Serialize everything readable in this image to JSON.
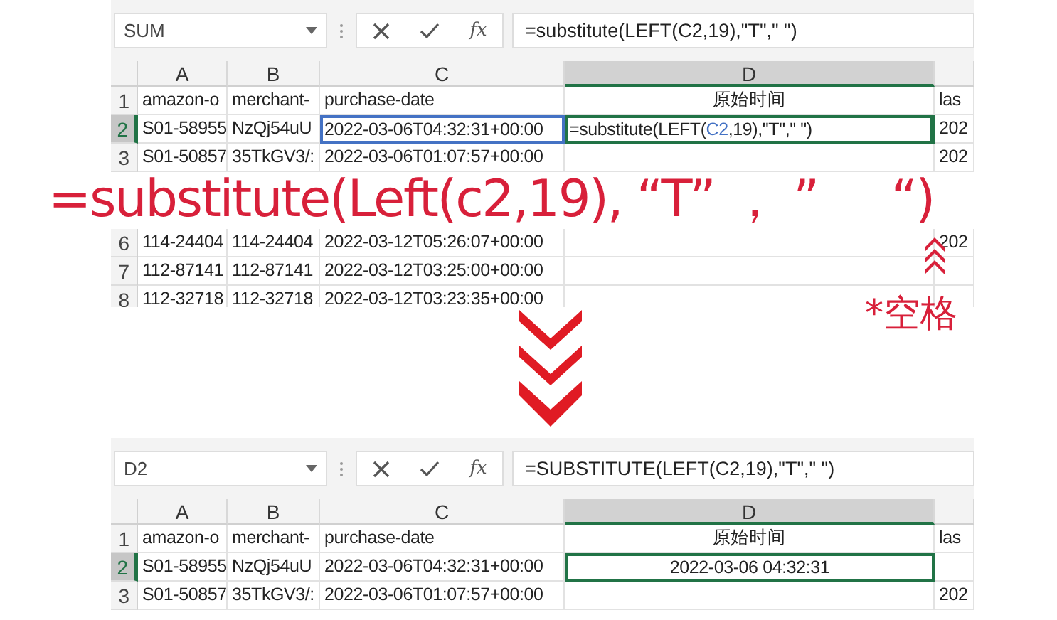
{
  "top_sheet": {
    "name_box": "SUM",
    "function_label": "fx",
    "formula": "=substitute(LEFT(C2,19),\"T\",\" \")",
    "editing": true,
    "columns": [
      {
        "label": "A",
        "selected": false
      },
      {
        "label": "B",
        "selected": false
      },
      {
        "label": "C",
        "selected": false
      },
      {
        "label": "D",
        "selected": true
      },
      {
        "selected": false
      }
    ],
    "rows": [
      {
        "number": "1",
        "selected": false,
        "cells": [
          {
            "text": "amazon-o",
            "selected": false
          },
          {
            "text": "merchant-",
            "selected": false
          },
          {
            "text": "purchase-date",
            "selected": false
          },
          {
            "text": "原始时间",
            "centered": true,
            "selected": false
          },
          {
            "text": "las",
            "selected": false
          }
        ]
      },
      {
        "number": "2",
        "selected": true,
        "cells": [
          {
            "text": "S01-58955",
            "selected": false
          },
          {
            "text": "NzQj54uU",
            "selected": false
          },
          {
            "text": "2022-03-06T04:32:31+00:00",
            "referenced": true,
            "selected": false
          },
          {
            "parts": [
              {
                "text": "=substitute(LEFT(",
                "kind": "plain"
              },
              {
                "text": "C2",
                "kind": "ref"
              },
              {
                "text": ",19),\"T\",\" \")",
                "kind": "plain"
              }
            ],
            "selected": true
          },
          {
            "text": "202",
            "selected": false
          }
        ]
      },
      {
        "number": "3",
        "selected": false,
        "cells": [
          {
            "text": "S01-50857",
            "selected": false
          },
          {
            "text": "35TkGV3/:",
            "selected": false
          },
          {
            "text": "2022-03-06T01:07:57+00:00",
            "selected": false
          },
          null,
          {
            "text": "202",
            "selected": false
          }
        ]
      },
      {
        "cells": [
          null,
          null,
          null,
          null,
          null
        ]
      },
      {
        "cells": [
          null,
          null,
          null,
          null,
          null
        ]
      },
      {
        "number": "6",
        "selected": false,
        "cells": [
          {
            "text": "114-24404",
            "selected": false
          },
          {
            "text": "114-24404",
            "selected": false
          },
          {
            "text": "2022-03-12T05:26:07+00:00",
            "selected": false
          },
          null,
          {
            "text": "202",
            "selected": false
          }
        ]
      },
      {
        "number": "7",
        "selected": false,
        "cells": [
          {
            "text": "112-87141",
            "selected": false
          },
          {
            "text": "112-87141",
            "selected": false
          },
          {
            "text": "2022-03-12T03:25:00+00:00",
            "selected": false
          },
          null,
          null
        ]
      },
      {
        "number": "8",
        "selected": false,
        "cells": [
          {
            "text": "112-32718",
            "selected": false
          },
          {
            "text": "112-32718",
            "selected": false
          },
          {
            "text": "2022-03-12T03:23:35+00:00",
            "selected": false
          },
          null,
          null
        ]
      }
    ]
  },
  "annotations": [
    {
      "kind": "formula",
      "text": "=substitute(Left(c2,19), “T” ， ”     “)"
    },
    {
      "kind": "label",
      "text": "*空格"
    }
  ],
  "bottom_sheet": {
    "name_box": "D2",
    "function_label": "fx",
    "formula": "=SUBSTITUTE(LEFT(C2,19),\"T\",\" \")",
    "columns": [
      {
        "label": "A",
        "selected": false
      },
      {
        "label": "B",
        "selected": false
      },
      {
        "label": "C",
        "selected": false
      },
      {
        "label": "D",
        "selected": true
      },
      {
        "selected": false
      }
    ],
    "rows": [
      {
        "number": "1",
        "selected": false,
        "cells": [
          {
            "text": "amazon-o",
            "selected": false
          },
          {
            "text": "merchant-",
            "selected": false
          },
          {
            "text": "purchase-date",
            "selected": false
          },
          {
            "text": "原始时间",
            "centered": true,
            "selected": false
          },
          {
            "text": "las",
            "selected": false
          }
        ]
      },
      {
        "number": "2",
        "selected": true,
        "cells": [
          {
            "text": "S01-58955",
            "selected": false
          },
          {
            "text": "NzQj54uU",
            "selected": false
          },
          {
            "text": "2022-03-06T04:32:31+00:00",
            "selected": false
          },
          {
            "text": "2022-03-06 04:32:31",
            "centered": true,
            "selected": true
          },
          null
        ]
      },
      {
        "number": "3",
        "selected": false,
        "cells": [
          {
            "text": "S01-50857",
            "selected": false
          },
          {
            "text": "35TkGV3/:",
            "selected": false
          },
          {
            "text": "2022-03-06T01:07:57+00:00",
            "selected": false
          },
          null,
          {
            "text": "202",
            "selected": false
          }
        ]
      }
    ]
  }
}
